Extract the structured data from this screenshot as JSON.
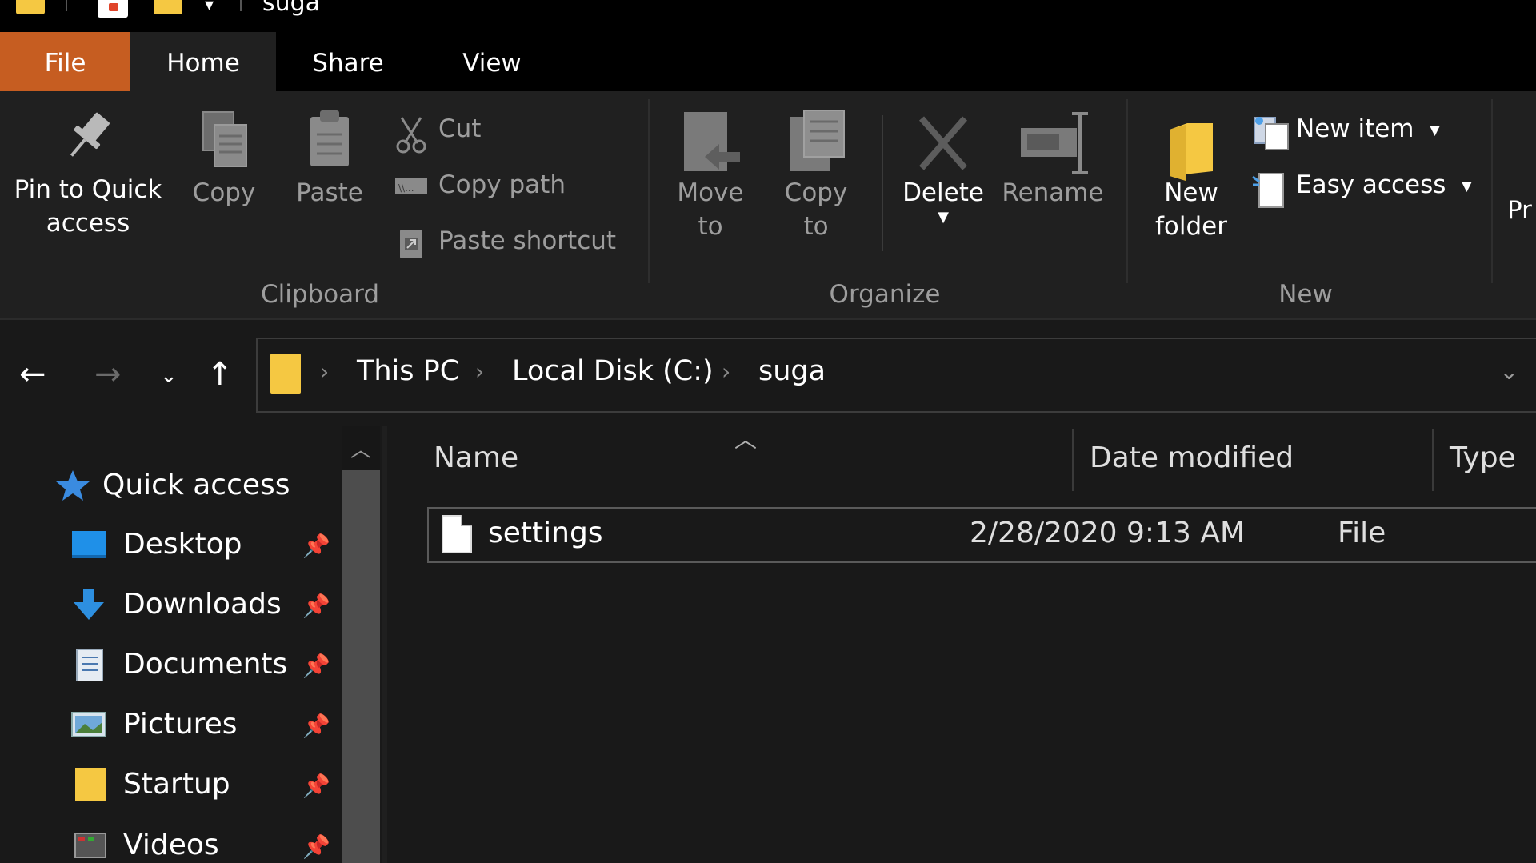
{
  "titlebar": {
    "title": "suga",
    "dropdown": "▾"
  },
  "ribbon_tabs": [
    "File",
    "Home",
    "Share",
    "View"
  ],
  "ribbon": {
    "clipboard": {
      "pin": "Pin to Quick\naccess",
      "copy": "Copy",
      "paste": "Paste",
      "cut": "Cut",
      "copy_path": "Copy path",
      "paste_shortcut": "Paste shortcut",
      "label": "Clipboard"
    },
    "organize": {
      "move_to": "Move\nto",
      "copy_to": "Copy\nto",
      "delete": "Delete",
      "rename": "Rename",
      "label": "Organize"
    },
    "new": {
      "new_folder": "New\nfolder",
      "new_item": "New item",
      "easy_access": "Easy access",
      "label": "New"
    },
    "open_partial": "Pr"
  },
  "nav": {
    "back": "←",
    "forward": "→",
    "recent": "⌄",
    "up": "↑"
  },
  "address": {
    "crumbs": [
      "This PC",
      "Local Disk (C:)",
      "suga"
    ],
    "sep": "›",
    "dropdown": "⌄"
  },
  "navpane": {
    "items": [
      {
        "label": "Quick access",
        "icon": "star-icon"
      },
      {
        "label": "Desktop",
        "icon": "desktop-icon"
      },
      {
        "label": "Downloads",
        "icon": "downloads-icon"
      },
      {
        "label": "Documents",
        "icon": "documents-icon"
      },
      {
        "label": "Pictures",
        "icon": "pictures-icon"
      },
      {
        "label": "Startup",
        "icon": "folder-icon"
      },
      {
        "label": "Videos",
        "icon": "videos-icon"
      }
    ]
  },
  "filelist": {
    "columns": [
      "Name",
      "Date modified",
      "Type"
    ],
    "rows": [
      {
        "name": "settings",
        "date": "2/28/2020 9:13 AM",
        "type": "File"
      }
    ]
  },
  "colors": {
    "file_tab": "#c65d21",
    "background": "#191919",
    "ribbon": "#202020"
  }
}
